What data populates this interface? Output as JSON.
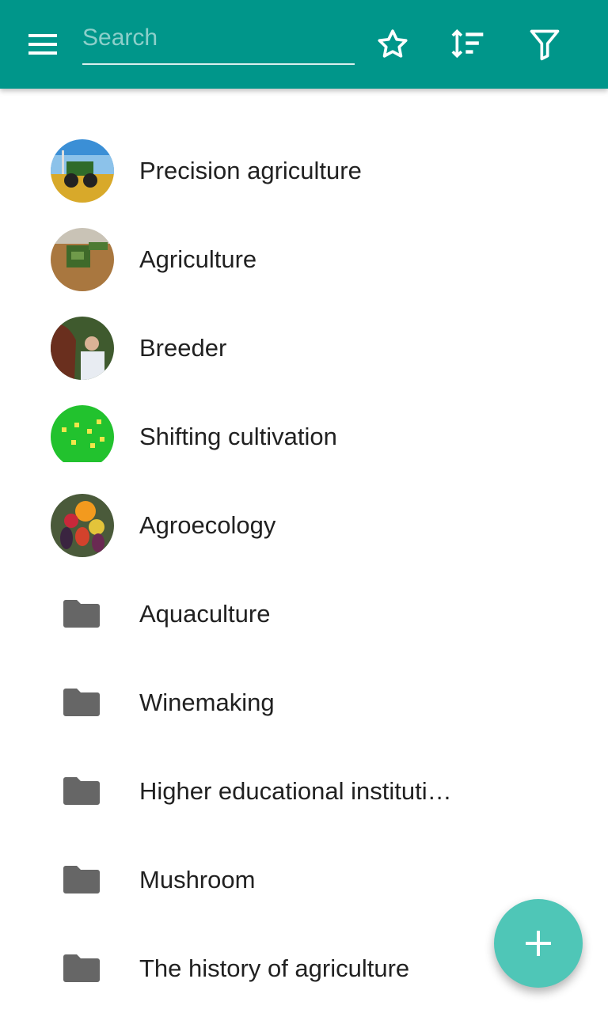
{
  "header": {
    "menu_icon": "menu-icon",
    "search": {
      "placeholder": "Search",
      "value": ""
    },
    "actions": [
      {
        "icon": "star-outline-icon"
      },
      {
        "icon": "sort-icon"
      },
      {
        "icon": "filter-icon"
      }
    ],
    "color": "#00968a"
  },
  "items": [
    {
      "label": "Precision agriculture",
      "kind": "image"
    },
    {
      "label": "Agriculture",
      "kind": "image"
    },
    {
      "label": "Breeder",
      "kind": "image"
    },
    {
      "label": "Shifting cultivation",
      "kind": "image"
    },
    {
      "label": "Agroecology",
      "kind": "image"
    },
    {
      "label": "Aquaculture",
      "kind": "folder"
    },
    {
      "label": "Winemaking",
      "kind": "folder"
    },
    {
      "label": "Higher educational instituti…",
      "kind": "folder"
    },
    {
      "label": "Mushroom",
      "kind": "folder"
    },
    {
      "label": "The history of agriculture",
      "kind": "folder"
    }
  ],
  "fab": {
    "icon": "plus-icon",
    "color": "#4fc6b7"
  }
}
